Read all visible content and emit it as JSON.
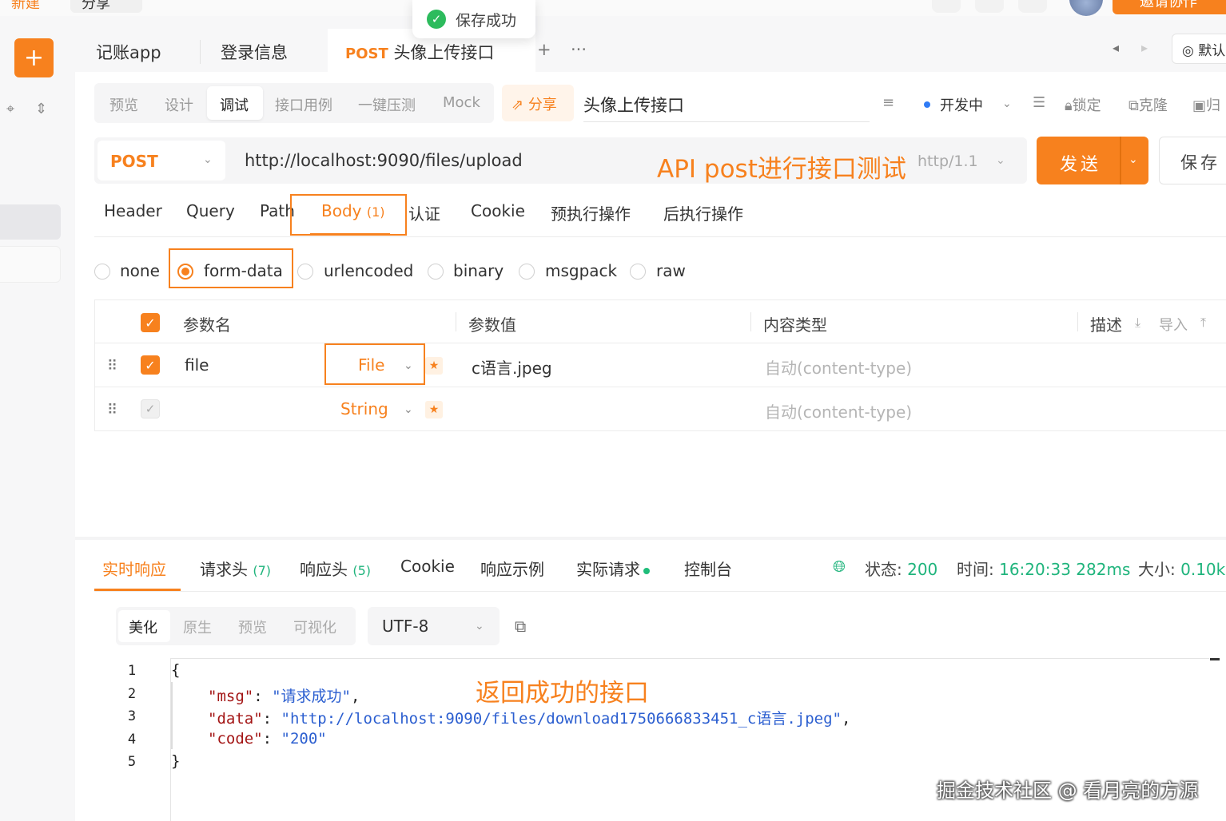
{
  "top": {
    "new_label": "新建",
    "share_label": "分享",
    "invite_label": "邀请协作"
  },
  "toast": {
    "message": "保存成功"
  },
  "tabs": [
    {
      "label": "记账app"
    },
    {
      "label": "登录信息"
    },
    {
      "method": "POST",
      "label": "头像上传接口",
      "active": true
    }
  ],
  "env_label": "默认",
  "subtabs": [
    "预览",
    "设计",
    "调试",
    "接口用例",
    "一键压测",
    "Mock"
  ],
  "active_subtab": "调试",
  "share_btn": "分享",
  "api_name": "头像上传接口",
  "status_label": "开发中",
  "tools": {
    "lock": "锁定",
    "clone": "克隆",
    "archive": "归"
  },
  "request": {
    "method": "POST",
    "url": "http://localhost:9090/files/upload",
    "protocol": "http/1.1",
    "send_label": "发送",
    "save_label": "保存"
  },
  "annotation_api": "API post进行接口测试",
  "param_tabs": [
    {
      "label": "Header"
    },
    {
      "label": "Query"
    },
    {
      "label": "Path"
    },
    {
      "label": "Body",
      "count": "(1)",
      "active": true
    },
    {
      "label": "认证"
    },
    {
      "label": "Cookie"
    },
    {
      "label": "预执行操作"
    },
    {
      "label": "后执行操作"
    }
  ],
  "body_types": [
    "none",
    "form-data",
    "urlencoded",
    "binary",
    "msgpack",
    "raw"
  ],
  "selected_body_type": "form-data",
  "table": {
    "headers": {
      "name": "参数名",
      "value": "参数值",
      "content_type": "内容类型",
      "desc": "描述",
      "import": "导入"
    },
    "rows": [
      {
        "checked": true,
        "name": "file",
        "type": "File",
        "value": "c语言.jpeg",
        "content_type": "自动(content-type)"
      },
      {
        "checked": false,
        "name": "",
        "type": "String",
        "value": "",
        "content_type": "自动(content-type)"
      }
    ]
  },
  "response_tabs": [
    {
      "label": "实时响应",
      "active": true
    },
    {
      "label": "请求头",
      "count": "(7)"
    },
    {
      "label": "响应头",
      "count": "(5)"
    },
    {
      "label": "Cookie"
    },
    {
      "label": "响应示例"
    },
    {
      "label": "实际请求"
    },
    {
      "label": "控制台"
    }
  ],
  "status": {
    "status_label": "状态:",
    "status_value": "200",
    "time_label": "时间:",
    "time_value": "16:20:33",
    "duration": "282ms",
    "size_label": "大小:",
    "size_value": "0.10k"
  },
  "format_tabs": [
    "美化",
    "原生",
    "预览",
    "可视化"
  ],
  "encoding": "UTF-8",
  "code_lines": [
    {
      "no": "1",
      "text": "{"
    },
    {
      "no": "2",
      "key": "\"msg\"",
      "value": "\"请求成功\"",
      "tail": ","
    },
    {
      "no": "3",
      "key": "\"data\"",
      "value": "\"http://localhost:9090/files/download1750666833451_c语言.jpeg\"",
      "tail": ","
    },
    {
      "no": "4",
      "key": "\"code\"",
      "value": "\"200\"",
      "tail": ""
    },
    {
      "no": "5",
      "text": "}"
    }
  ],
  "annotation_resp": "返回成功的接口",
  "watermark": "掘金技术社区 @ 看月亮的方源",
  "colors": {
    "accent": "#f7811e",
    "success": "#1fb47c",
    "status_dot": "#2f7bf5"
  }
}
